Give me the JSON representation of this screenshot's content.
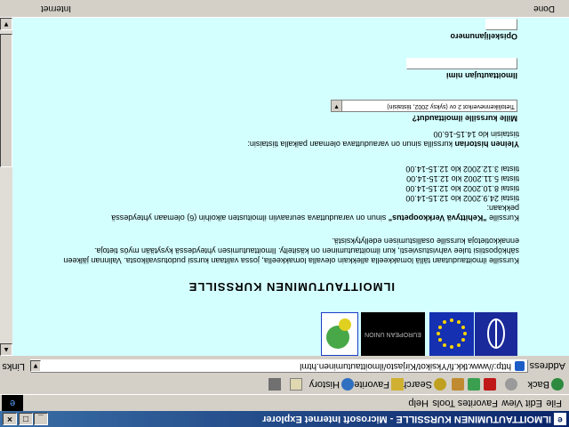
{
  "window": {
    "title": "ILMOITTAUTUMINEN KURSSILLE - Microsoft Internet Explorer"
  },
  "menu": {
    "items": [
      "File",
      "Edit",
      "View",
      "Favorites",
      "Tools",
      "Help"
    ]
  },
  "toolbar": {
    "back_label": "Back",
    "search_label": "Search",
    "favorites_label": "Favorites",
    "history_label": "History"
  },
  "address": {
    "label": "Address",
    "url": "http://www.tkk.fi/Yksikot/Kirjasto/ilmoittautuminen.html",
    "go_label": "Links"
  },
  "page": {
    "logo3_text": "EUROPEAN UNION",
    "heading": "ILMOITTAUTUMINEN KURSSILLE",
    "intro_line1": "Kurssille ilmoittaudutaan tällä lomakkeella allekkain olevalla lomakkeella, jossa valitaan kurssi pudotusvalikosta. Valinnan jälkeen",
    "intro_line2": "sähköpostiisi tulee vahvistusviesti, kun ilmoittautuminen on käsitelty. Ilmoittautumisen yhteydessä kysytään myös tietoja.",
    "intro_line3": "ennakkotietoja kurssille osallistumisen edellytyksistä.",
    "course1_prefix": "Kurssille",
    "course1_name": "\"Kehittyvä Verkkoopetus\"",
    "course1_suffix": "sinun on varauduttava seuraaviin ilmoitusten aikoihin (6) olemaan yhteydessä",
    "course1_label": "pekkaan:",
    "dates": [
      "tiistai 24.9.2002 klo 12.15-14.00",
      "tiistai 8.10.2002 klo 12.15-14.00",
      "tiistai 5.11.2002 klo 12.15-14.00",
      "tiistai 3.12.2002 klo 12.15-14.00"
    ],
    "course2_prefix": "Yleinen historian",
    "course2_suffix": "kurssilla sinun on varauduttava olemaan paikalla tiistaisin:",
    "course2_time": "tiistaisin klo 14.15-16.00",
    "question_course": "Mille kurssille ilmoittaudut?",
    "course_select_value": "Tietoliikenneverkot 2 ov (syksy 2002, tiistaisin)",
    "label_name": "Ilmoittautujan nimi",
    "label_student_number": "Opiskelijanumero"
  },
  "status": {
    "text": "Done",
    "zone": "Internet"
  }
}
